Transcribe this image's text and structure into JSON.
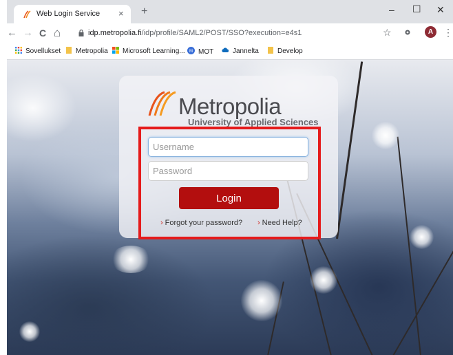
{
  "browser": {
    "tab": {
      "title": "Web Login Service",
      "close": "×"
    },
    "new_tab": "+",
    "window_controls": {
      "minimize": "–",
      "maximize": "☐",
      "close": "✕"
    },
    "nav": {
      "back": "←",
      "forward": "→",
      "reload": "C",
      "home": "⌂"
    },
    "url": {
      "host": "idp.metropolia.fi",
      "path": "/idp/profile/SAML2/POST/SSO?execution=e4s1"
    },
    "star": "☆",
    "profile_initial": "A",
    "menu": "⋮",
    "bookmarks": [
      {
        "label": "Sovellukset",
        "icon": "apps-grid-icon"
      },
      {
        "label": "Metropolia",
        "icon": "folder-icon"
      },
      {
        "label": "Microsoft Learning...",
        "icon": "microsoft-icon"
      },
      {
        "label": "MOT",
        "icon": "mot-icon"
      },
      {
        "label": "Jannelta",
        "icon": "cloud-icon"
      },
      {
        "label": "Develop",
        "icon": "folder-icon"
      }
    ]
  },
  "login": {
    "logo_name": "Metropolia",
    "logo_subtitle": "University of Applied Sciences",
    "username_placeholder": "Username",
    "password_placeholder": "Password",
    "login_label": "Login",
    "forgot_password": "Forgot your password?",
    "need_help": "Need Help?"
  },
  "colors": {
    "accent": "#b30e0e",
    "highlight": "#e51b1b",
    "logo_orange": "#f28a1e"
  }
}
